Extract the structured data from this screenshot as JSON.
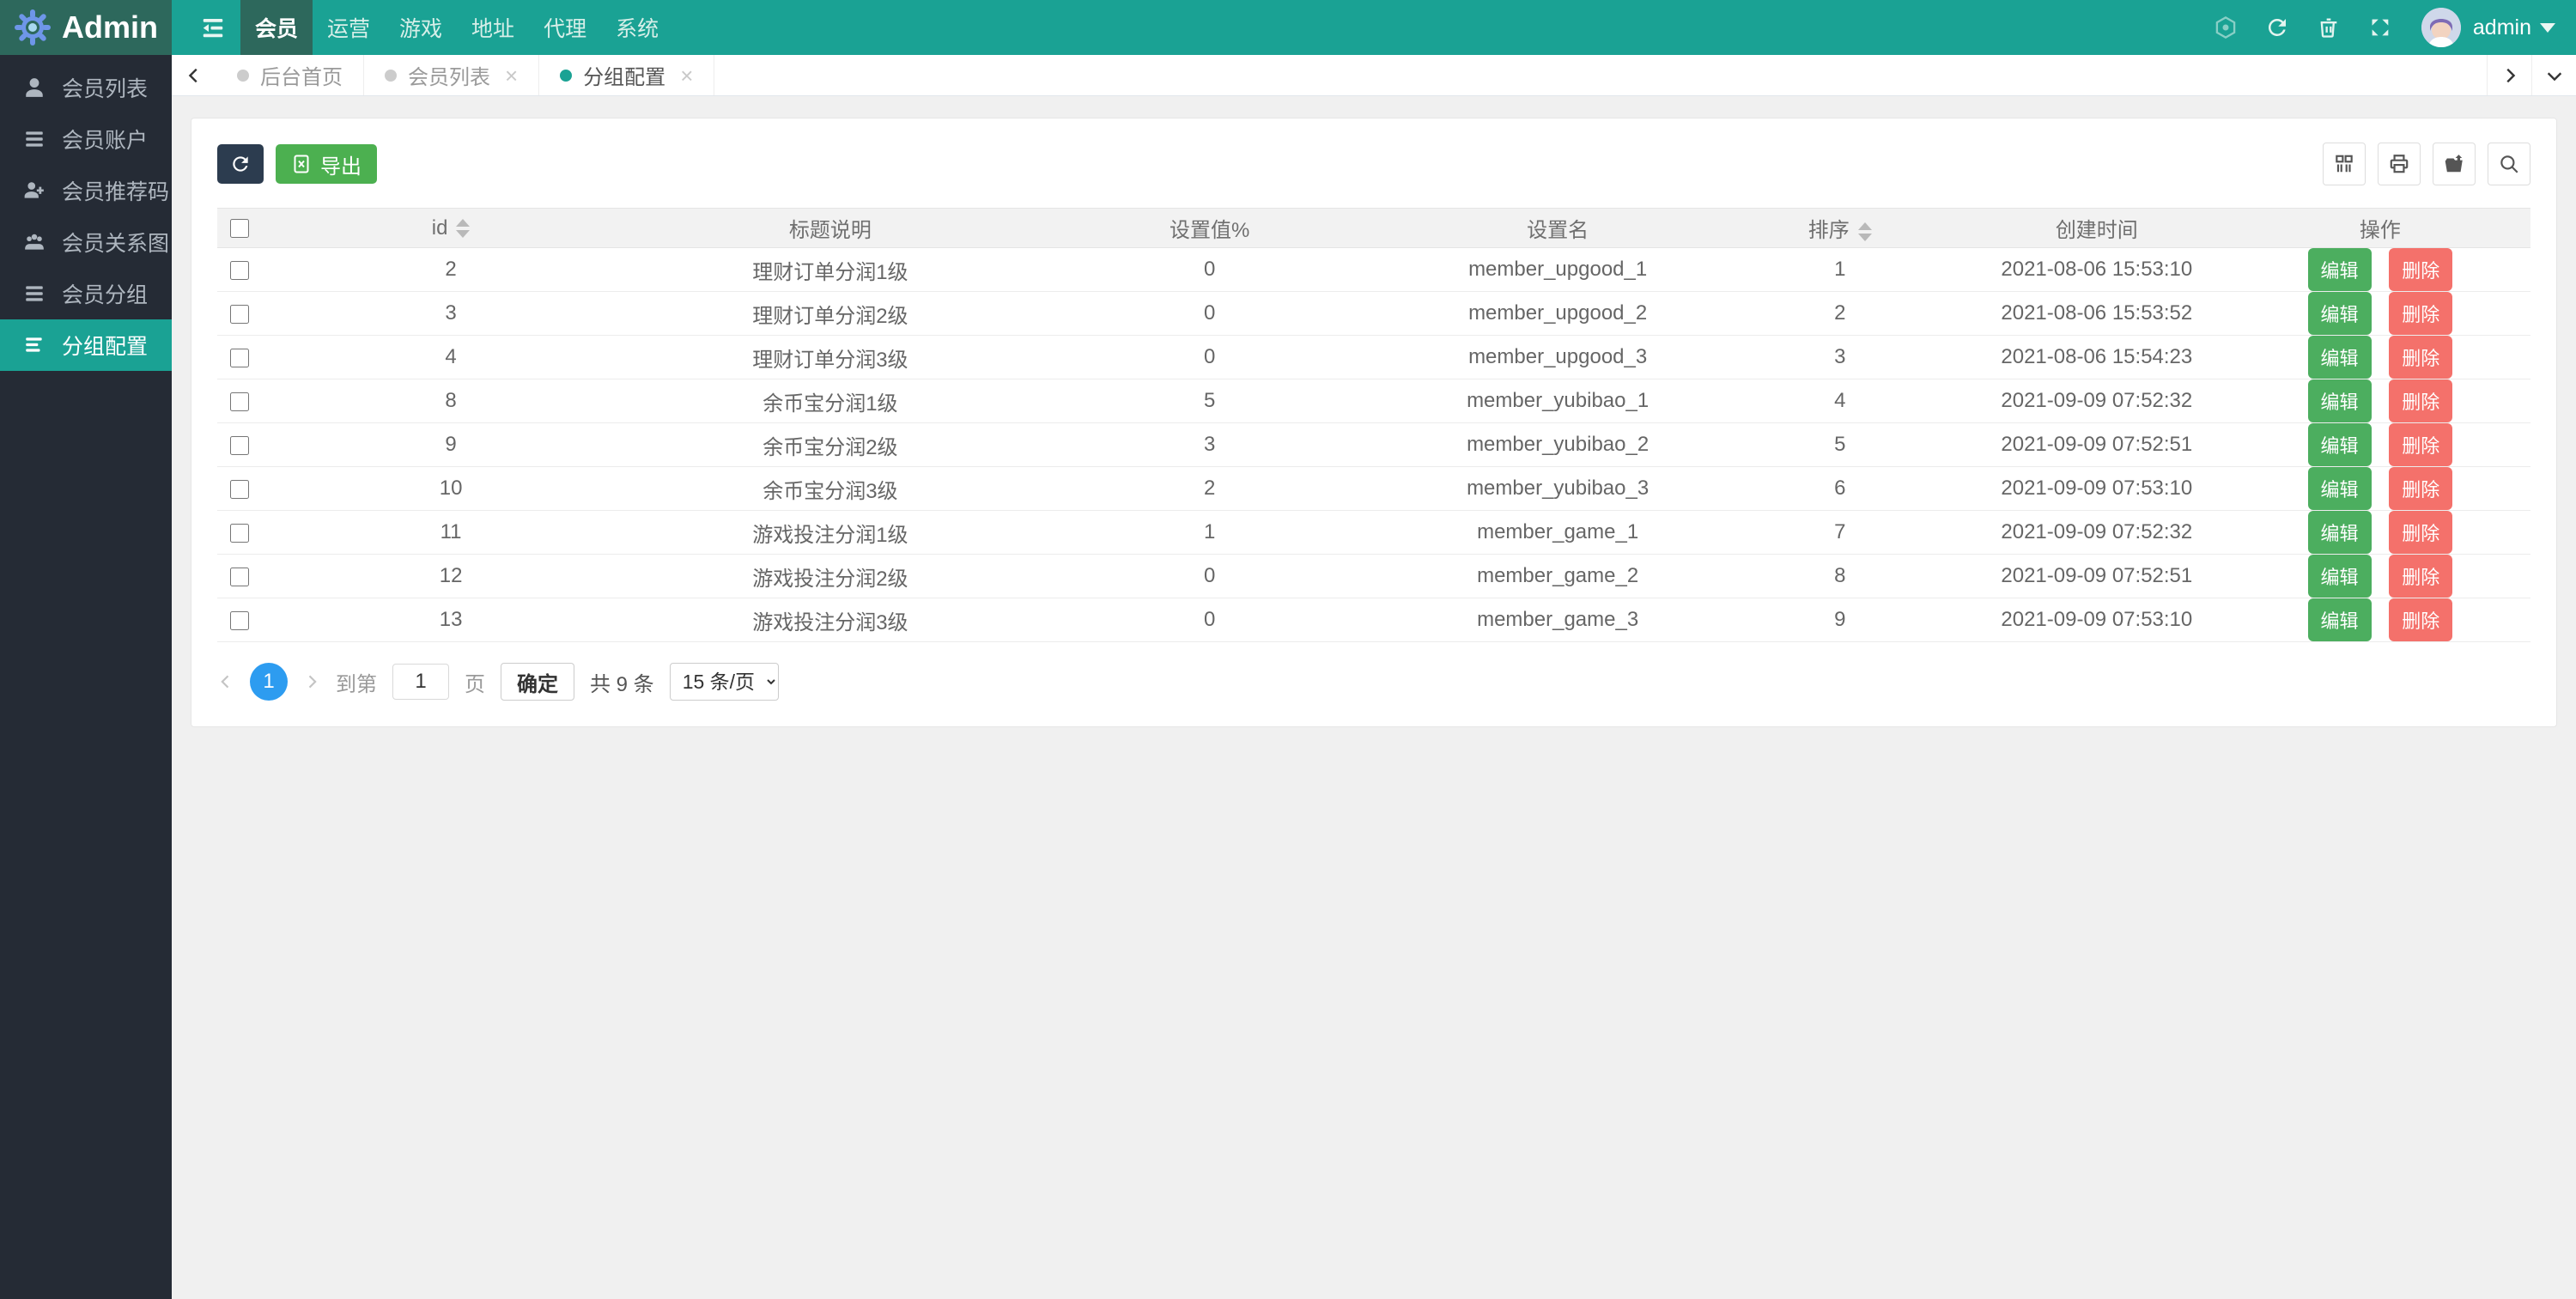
{
  "navbar": {
    "brand": "Admin",
    "menu": {
      "member": "会员",
      "operation": "运营",
      "game": "游戏",
      "address": "地址",
      "agent": "代理",
      "system": "系统"
    },
    "user_name": "admin"
  },
  "sidebar": {
    "items": [
      {
        "label": "会员列表",
        "icon": "user-icon"
      },
      {
        "label": "会员账户",
        "icon": "list-icon"
      },
      {
        "label": "会员推荐码",
        "icon": "user-plus-icon"
      },
      {
        "label": "会员关系图",
        "icon": "users-icon"
      },
      {
        "label": "会员分组",
        "icon": "list-icon"
      },
      {
        "label": "分组配置",
        "icon": "align-left-icon",
        "active": true
      }
    ]
  },
  "tabs": {
    "items": [
      {
        "label": "后台首页"
      },
      {
        "label": "会员列表",
        "closable": true
      },
      {
        "label": "分组配置",
        "closable": true,
        "active": true
      }
    ]
  },
  "toolbar": {
    "export_label": "导出"
  },
  "table": {
    "columns": {
      "id": "id",
      "title": "标题说明",
      "value": "设置值%",
      "name": "设置名",
      "sort": "排序",
      "created": "创建时间",
      "actions": "操作"
    },
    "edit_label": "编辑",
    "delete_label": "删除",
    "rows": [
      {
        "id": 2,
        "title": "理财订单分润1级",
        "value": 0,
        "name": "member_upgood_1",
        "sort": 1,
        "created": "2021-08-06 15:53:10"
      },
      {
        "id": 3,
        "title": "理财订单分润2级",
        "value": 0,
        "name": "member_upgood_2",
        "sort": 2,
        "created": "2021-08-06 15:53:52"
      },
      {
        "id": 4,
        "title": "理财订单分润3级",
        "value": 0,
        "name": "member_upgood_3",
        "sort": 3,
        "created": "2021-08-06 15:54:23"
      },
      {
        "id": 8,
        "title": "余币宝分润1级",
        "value": 5,
        "name": "member_yubibao_1",
        "sort": 4,
        "created": "2021-09-09 07:52:32"
      },
      {
        "id": 9,
        "title": "余币宝分润2级",
        "value": 3,
        "name": "member_yubibao_2",
        "sort": 5,
        "created": "2021-09-09 07:52:51"
      },
      {
        "id": 10,
        "title": "余币宝分润3级",
        "value": 2,
        "name": "member_yubibao_3",
        "sort": 6,
        "created": "2021-09-09 07:53:10"
      },
      {
        "id": 11,
        "title": "游戏投注分润1级",
        "value": 1,
        "name": "member_game_1",
        "sort": 7,
        "created": "2021-09-09 07:52:32"
      },
      {
        "id": 12,
        "title": "游戏投注分润2级",
        "value": 0,
        "name": "member_game_2",
        "sort": 8,
        "created": "2021-09-09 07:52:51"
      },
      {
        "id": 13,
        "title": "游戏投注分润3级",
        "value": 0,
        "name": "member_game_3",
        "sort": 9,
        "created": "2021-09-09 07:53:10"
      }
    ]
  },
  "pagination": {
    "page": "1",
    "goto_prefix": "到第",
    "page_input": "1",
    "goto_suffix": "页",
    "confirm_label": "确定",
    "total_label": "共 9 条",
    "page_size_label": "15 条/页"
  },
  "colors": {
    "navbar_teal": "#1aa294",
    "navbar_dark": "#2d685c",
    "sidebar_dark": "#252b35",
    "active_teal": "#1aa294",
    "page_blue": "#2d9cf0",
    "edit_green": "#4cae5f",
    "export_green": "#4cb050",
    "delete_red": "#f4716b",
    "refresh_dark": "#2c3c4f"
  }
}
